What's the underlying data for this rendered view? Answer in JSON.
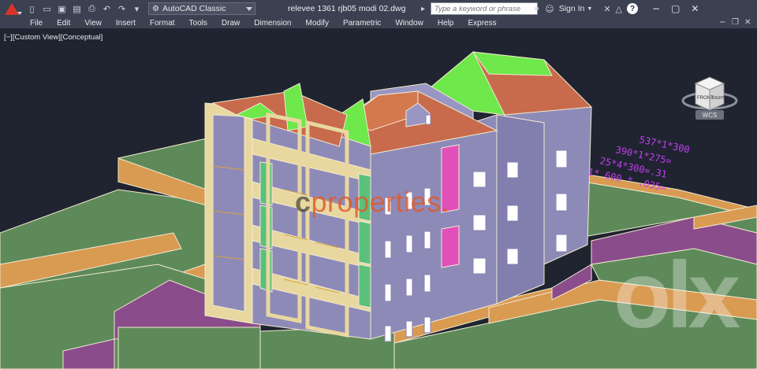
{
  "app": {
    "workspace": "AutoCAD Classic",
    "document_title": "relevee 1361 rjb05 modi 02.dwg"
  },
  "search": {
    "placeholder": "Type a keyword or phrase"
  },
  "account": {
    "signin_label": "Sign In"
  },
  "help": {
    "label": "?"
  },
  "menu": {
    "items": [
      "File",
      "Edit",
      "View",
      "Insert",
      "Format",
      "Tools",
      "Draw",
      "Dimension",
      "Modify",
      "Parametric",
      "Window",
      "Help",
      "Express"
    ]
  },
  "viewport": {
    "label": "[−][Custom View][Conceptual]",
    "viewcube": {
      "front": "FRONT",
      "right": "RIGHT"
    },
    "ucs": "WCS"
  },
  "watermarks": {
    "brand_c": "c",
    "brand": "properties.",
    "olx": "olx"
  },
  "annotation_lines": [
    "537*1*300",
    "390*1*275=",
    "25*4*300=.31",
    "1* 600 * .035="
  ],
  "colors": {
    "title_bar": "#3b4150",
    "viewport_bg": "#1f2430",
    "building_facade": "#8e8ab8",
    "roof": "#c86a4c",
    "roof_green": "#6ee84a",
    "terrain_top": "#5e8a5a",
    "terrain_edge": "#d99a52",
    "balcony_frame": "#e8d8a0",
    "annotation": "#c43cf0",
    "autocad_red": "#d9342b"
  }
}
